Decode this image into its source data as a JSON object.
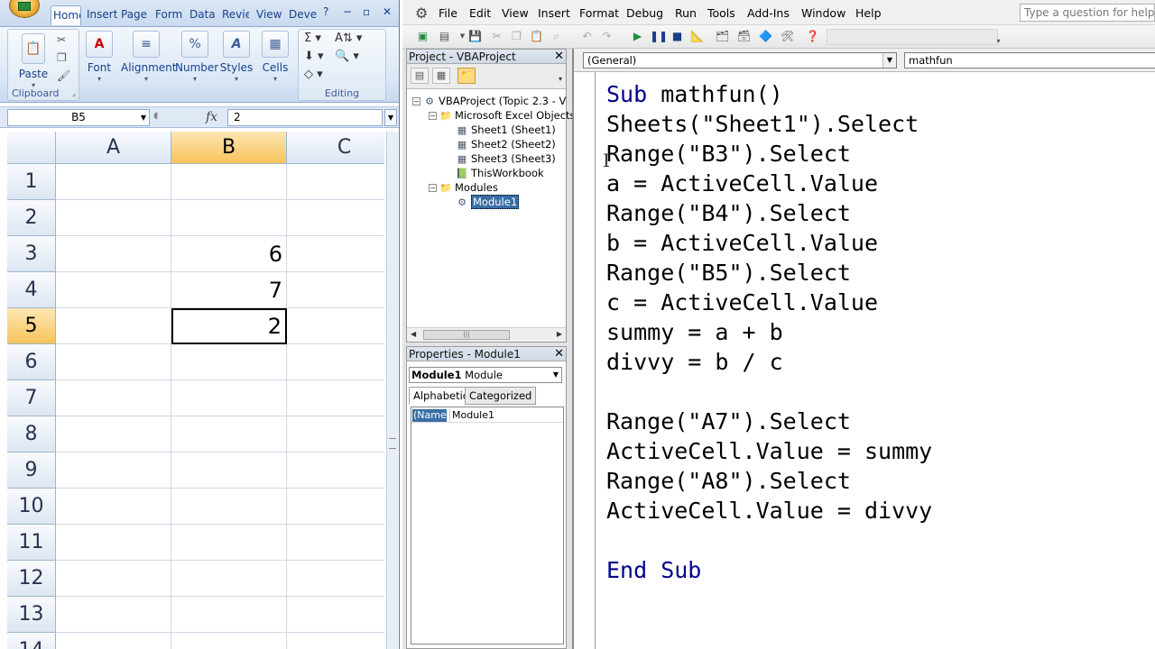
{
  "excel": {
    "tabs": [
      {
        "label": "Home",
        "active": true
      },
      {
        "label": "Insert"
      },
      {
        "label": "Page"
      },
      {
        "label": "Form"
      },
      {
        "label": "Data"
      },
      {
        "label": "Revie"
      },
      {
        "label": "View"
      },
      {
        "label": "Devel"
      }
    ],
    "ribbon": {
      "paste": "Paste",
      "clipboard": "Clipboard",
      "font": "Font",
      "font_icon": "A",
      "alignment": "Alignment",
      "number": "Number",
      "number_icon": "%",
      "styles": "Styles",
      "cells": "Cells",
      "editing": "Editing"
    },
    "formula_bar": {
      "name_box": "B5",
      "fx": "fx",
      "value": "2"
    },
    "columns": [
      "A",
      "B",
      "C"
    ],
    "rows": [
      {
        "num": "1",
        "b": ""
      },
      {
        "num": "2",
        "b": ""
      },
      {
        "num": "3",
        "b": "6"
      },
      {
        "num": "4",
        "b": "7"
      },
      {
        "num": "5",
        "b": "2"
      },
      {
        "num": "6",
        "b": ""
      },
      {
        "num": "7",
        "b": ""
      },
      {
        "num": "8",
        "b": ""
      },
      {
        "num": "9",
        "b": ""
      },
      {
        "num": "10",
        "b": ""
      },
      {
        "num": "11",
        "b": ""
      },
      {
        "num": "12",
        "b": ""
      },
      {
        "num": "13",
        "b": ""
      },
      {
        "num": "14",
        "b": ""
      }
    ]
  },
  "vbe": {
    "menu": [
      "File",
      "Edit",
      "View",
      "Insert",
      "Format",
      "Debug",
      "Run",
      "Tools",
      "Add-Ins",
      "Window",
      "Help"
    ],
    "help_placeholder": "Type a question for help",
    "project": {
      "title": "Project - VBAProject",
      "tree": [
        {
          "label": "VBAProject (Topic 2.3 - V",
          "icon": "vba-project-icon",
          "level": 0,
          "expander": "−"
        },
        {
          "label": "Microsoft Excel Objects",
          "icon": "folder-icon",
          "level": 1,
          "expander": "−"
        },
        {
          "label": "Sheet1 (Sheet1)",
          "icon": "sheet-icon",
          "level": 2
        },
        {
          "label": "Sheet2 (Sheet2)",
          "icon": "sheet-icon",
          "level": 2
        },
        {
          "label": "Sheet3 (Sheet3)",
          "icon": "sheet-icon",
          "level": 2
        },
        {
          "label": "ThisWorkbook",
          "icon": "workbook-icon",
          "level": 2
        },
        {
          "label": "Modules",
          "icon": "folder-icon",
          "level": 1,
          "expander": "−"
        },
        {
          "label": "Module1",
          "icon": "module-icon",
          "level": 2,
          "selected": true
        }
      ]
    },
    "properties": {
      "title": "Properties - Module1",
      "object_name": "Module1",
      "object_type": "Module",
      "tabs": [
        "Alphabetic",
        "Categorized"
      ],
      "row_key": "(Name)",
      "row_value": "Module1"
    },
    "code": {
      "object_combo": "(General)",
      "proc_combo": "mathfun",
      "lines": [
        "Sub mathfun()",
        "Sheets(\"Sheet1\").Select",
        "Range(\"B3\").Select",
        "a = ActiveCell.Value",
        "Range(\"B4\").Select",
        "b = ActiveCell.Value",
        "Range(\"B5\").Select",
        "c = ActiveCell.Value",
        "summy = a + b",
        "divvy = b / c",
        "",
        "Range(\"A7\").Select",
        "ActiveCell.Value = summy",
        "Range(\"A8\").Select",
        "ActiveCell.Value = divvy",
        "",
        "End Sub"
      ]
    }
  }
}
